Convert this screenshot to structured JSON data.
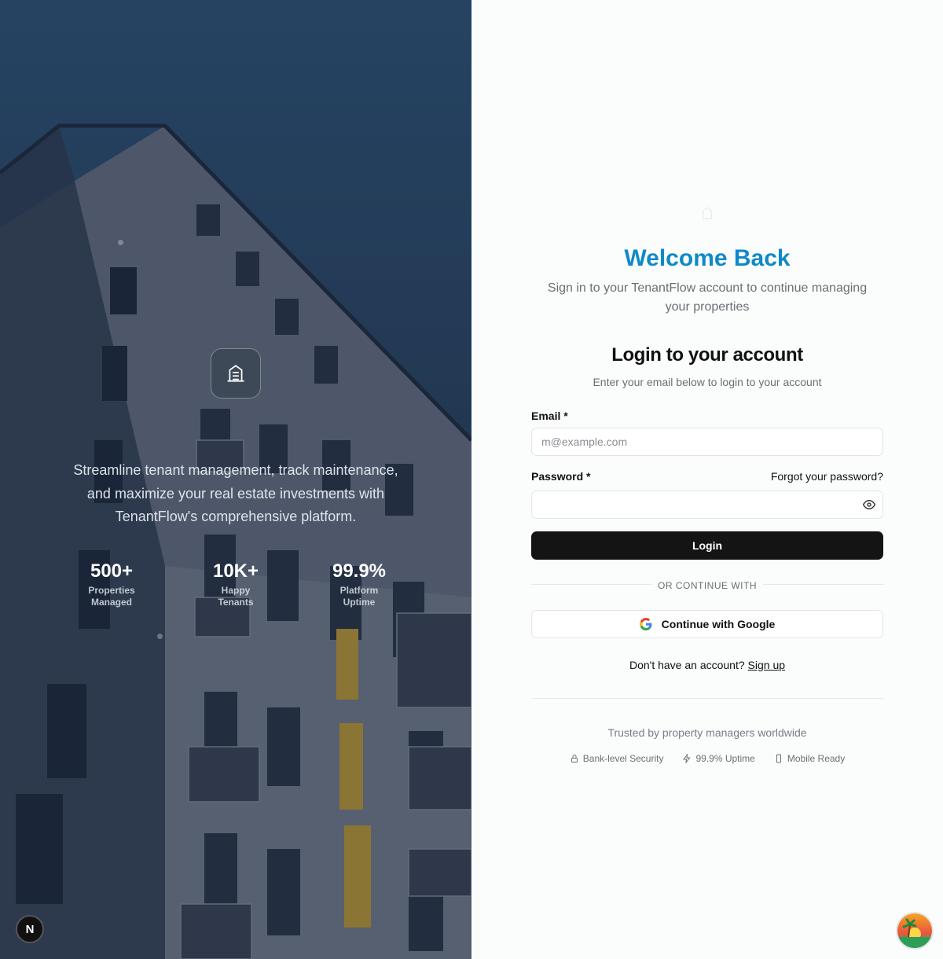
{
  "hero": {
    "tagline": "Streamline tenant management, track maintenance, and maximize your real estate investments with TenantFlow's comprehensive platform.",
    "logo_icon": "building-icon",
    "stats": [
      {
        "value": "500+",
        "label": "Properties Managed"
      },
      {
        "value": "10K+",
        "label": "Happy Tenants"
      },
      {
        "value": "99.9%",
        "label": "Platform Uptime"
      }
    ],
    "badge_letter": "N"
  },
  "header": {
    "title": "Welcome Back",
    "subtitle": "Sign in to your TenantFlow account to continue managing your properties"
  },
  "form": {
    "title": "Login to your account",
    "subtitle": "Enter your email below to login to your account",
    "email_label": "Email *",
    "email_placeholder": "m@example.com",
    "email_value": "",
    "password_label": "Password *",
    "password_value": "",
    "forgot_label": "Forgot your password?",
    "login_label": "Login",
    "divider_label": "OR CONTINUE WITH",
    "google_label": "Continue with Google",
    "signup_prompt": "Don't have an account?",
    "signup_link": "Sign up"
  },
  "footer": {
    "trusted": "Trusted by property managers worldwide",
    "badges": [
      {
        "icon": "lock-icon",
        "label": "Bank-level Security"
      },
      {
        "icon": "bolt-icon",
        "label": "99.9% Uptime"
      },
      {
        "icon": "phone-icon",
        "label": "Mobile Ready"
      }
    ]
  },
  "colors": {
    "accent": "#0f8ac6",
    "button": "#141414",
    "hero_sky": "#2e5478"
  }
}
